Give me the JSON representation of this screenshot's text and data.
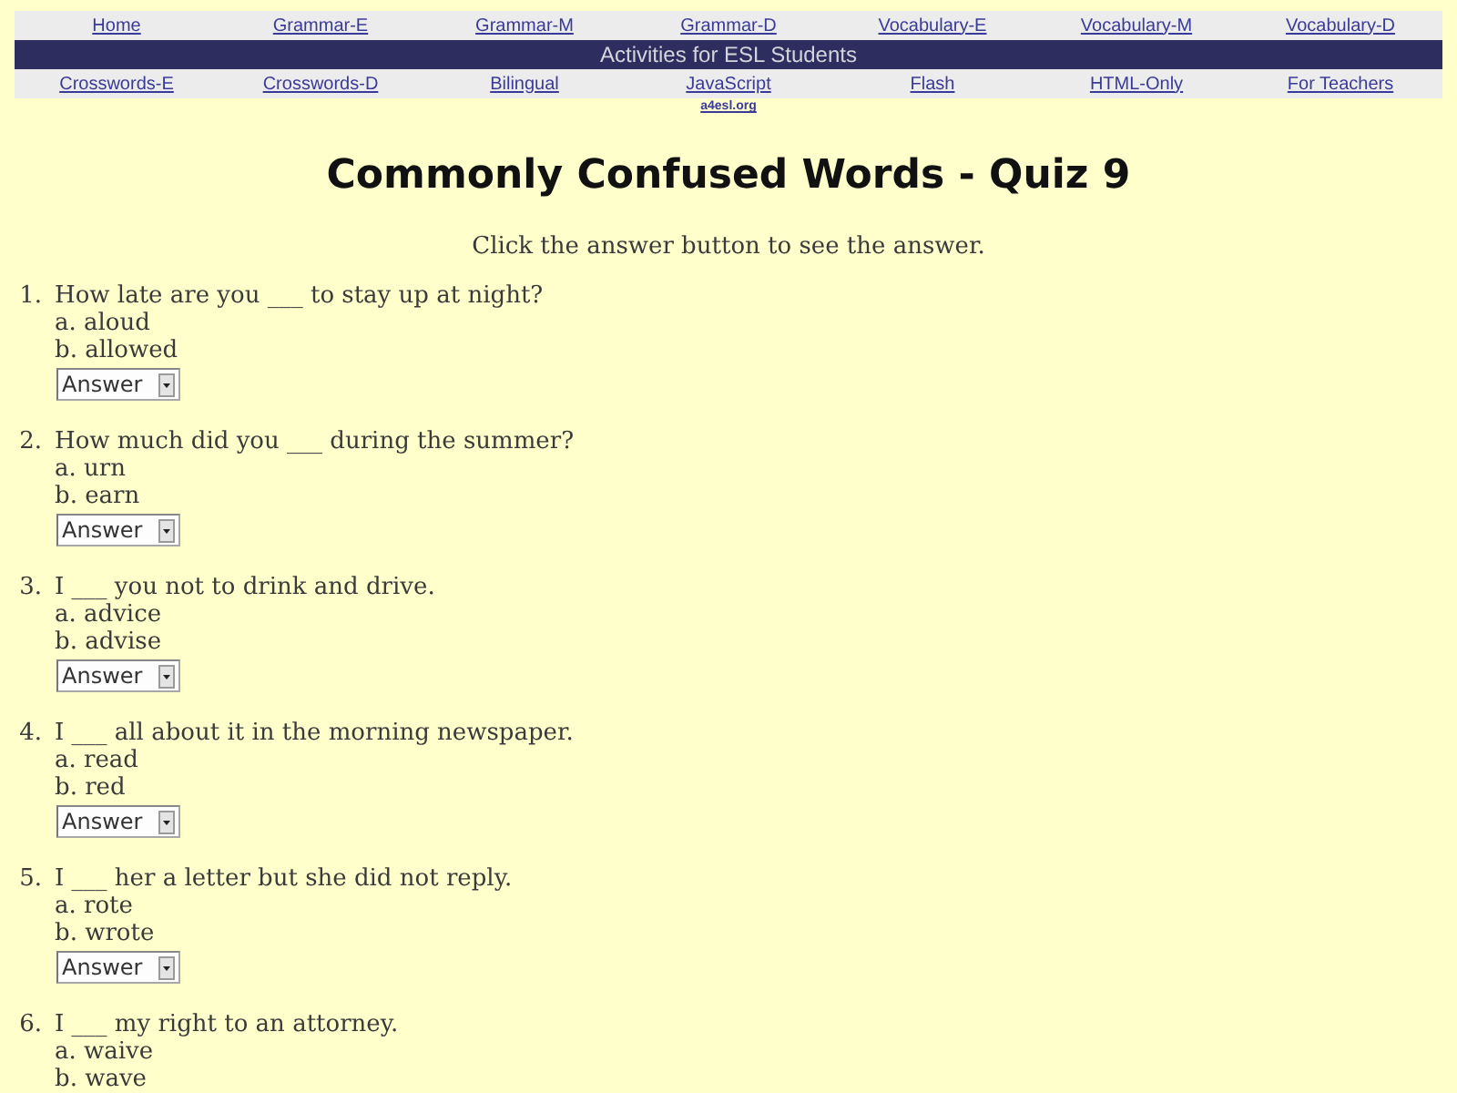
{
  "nav_top": [
    {
      "label": "Home"
    },
    {
      "label": "Grammar-E"
    },
    {
      "label": "Grammar-M"
    },
    {
      "label": "Grammar-D"
    },
    {
      "label": "Vocabulary-E"
    },
    {
      "label": "Vocabulary-M"
    },
    {
      "label": "Vocabulary-D"
    }
  ],
  "banner": {
    "text": "Activities for ESL Students"
  },
  "nav_bottom": [
    {
      "label": "Crosswords-E"
    },
    {
      "label": "Crosswords-D"
    },
    {
      "label": "Bilingual"
    },
    {
      "label": "JavaScript",
      "note": "a4esl.org"
    },
    {
      "label": "Flash"
    },
    {
      "label": "HTML-Only"
    },
    {
      "label": "For Teachers"
    }
  ],
  "title": "Commonly Confused Words - Quiz 9",
  "instruction": "Click the answer button to see the answer.",
  "questions": [
    {
      "number": "1.",
      "text": "How late are you ___ to stay up at night?",
      "options": [
        "a. aloud",
        "b. allowed"
      ],
      "answer_select": {
        "value": "Answer"
      }
    },
    {
      "number": "2.",
      "text": "How much did you ___ during the summer?",
      "options": [
        "a. urn",
        "b. earn"
      ],
      "answer_select": {
        "value": "Answer"
      }
    },
    {
      "number": "3.",
      "text": "I ___ you not to drink and drive.",
      "options": [
        "a. advice",
        "b. advise"
      ],
      "answer_select": {
        "value": "Answer"
      }
    },
    {
      "number": "4.",
      "text": "I ___ all about it in the morning newspaper.",
      "options": [
        "a. read",
        "b. red"
      ],
      "answer_select": {
        "value": "Answer"
      }
    },
    {
      "number": "5.",
      "text": "I ___ her a letter but she did not reply.",
      "options": [
        "a. rote",
        "b. wrote"
      ],
      "answer_select": {
        "value": "Answer"
      }
    },
    {
      "number": "6.",
      "text": "I ___ my right to an attorney.",
      "options": [
        "a. waive",
        "b. wave"
      ]
    }
  ]
}
